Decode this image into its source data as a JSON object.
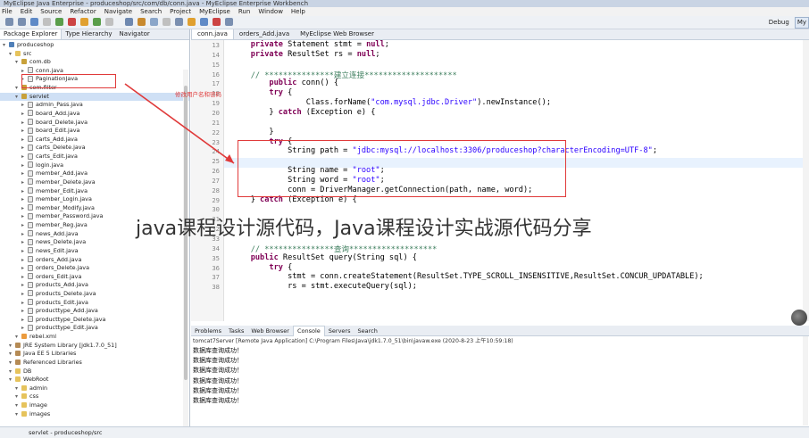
{
  "window_title": "MyEclipse Java Enterprise - produceshop/src/com/db/conn.java - MyEclipse Enterprise Workbench",
  "menu": [
    "File",
    "Edit",
    "Source",
    "Refactor",
    "Navigate",
    "Search",
    "Project",
    "MyEclipse",
    "Run",
    "Window",
    "Help"
  ],
  "perspectives": [
    "Debug",
    "My"
  ],
  "left_tabs": [
    "Package Explorer",
    "Type Hierarchy",
    "Navigator"
  ],
  "tree": [
    {
      "label": "produceshop",
      "indent": 0,
      "icon": "proj"
    },
    {
      "label": "src",
      "indent": 1,
      "icon": "fold"
    },
    {
      "label": "com.db",
      "indent": 2,
      "icon": "pkg"
    },
    {
      "label": "conn.java",
      "indent": 3,
      "icon": "jf"
    },
    {
      "label": "PaginationJava",
      "indent": 3,
      "icon": "jf"
    },
    {
      "label": "com.filter",
      "indent": 2,
      "icon": "pkg"
    },
    {
      "label": "servlet",
      "indent": 2,
      "icon": "pkg"
    },
    {
      "label": "admin_Pass.java",
      "indent": 3,
      "icon": "jf"
    },
    {
      "label": "board_Add.java",
      "indent": 3,
      "icon": "jf"
    },
    {
      "label": "board_Delete.java",
      "indent": 3,
      "icon": "jf"
    },
    {
      "label": "board_Edit.java",
      "indent": 3,
      "icon": "jf"
    },
    {
      "label": "carts_Add.java",
      "indent": 3,
      "icon": "jf"
    },
    {
      "label": "carts_Delete.java",
      "indent": 3,
      "icon": "jf"
    },
    {
      "label": "carts_Edit.java",
      "indent": 3,
      "icon": "jf"
    },
    {
      "label": "login.java",
      "indent": 3,
      "icon": "jf"
    },
    {
      "label": "member_Add.java",
      "indent": 3,
      "icon": "jf"
    },
    {
      "label": "member_Delete.java",
      "indent": 3,
      "icon": "jf"
    },
    {
      "label": "member_Edit.java",
      "indent": 3,
      "icon": "jf"
    },
    {
      "label": "member_Login.java",
      "indent": 3,
      "icon": "jf"
    },
    {
      "label": "member_Modify.java",
      "indent": 3,
      "icon": "jf"
    },
    {
      "label": "member_Password.java",
      "indent": 3,
      "icon": "jf"
    },
    {
      "label": "member_Reg.java",
      "indent": 3,
      "icon": "jf"
    },
    {
      "label": "news_Add.java",
      "indent": 3,
      "icon": "jf"
    },
    {
      "label": "news_Delete.java",
      "indent": 3,
      "icon": "jf"
    },
    {
      "label": "news_Edit.java",
      "indent": 3,
      "icon": "jf"
    },
    {
      "label": "orders_Add.java",
      "indent": 3,
      "icon": "jf"
    },
    {
      "label": "orders_Delete.java",
      "indent": 3,
      "icon": "jf"
    },
    {
      "label": "orders_Edit.java",
      "indent": 3,
      "icon": "jf"
    },
    {
      "label": "products_Add.java",
      "indent": 3,
      "icon": "jf"
    },
    {
      "label": "products_Delete.java",
      "indent": 3,
      "icon": "jf"
    },
    {
      "label": "products_Edit.java",
      "indent": 3,
      "icon": "jf"
    },
    {
      "label": "producttype_Add.java",
      "indent": 3,
      "icon": "jf"
    },
    {
      "label": "producttype_Delete.java",
      "indent": 3,
      "icon": "jf"
    },
    {
      "label": "producttype_Edit.java",
      "indent": 3,
      "icon": "jf"
    },
    {
      "label": "rebel.xml",
      "indent": 2,
      "icon": "xml"
    },
    {
      "label": "JRE System Library [jdk1.7.0_51]",
      "indent": 1,
      "icon": "lib"
    },
    {
      "label": "Java EE 5 Libraries",
      "indent": 1,
      "icon": "lib"
    },
    {
      "label": "Referenced Libraries",
      "indent": 1,
      "icon": "lib"
    },
    {
      "label": "DB",
      "indent": 1,
      "icon": "fold"
    },
    {
      "label": "WebRoot",
      "indent": 1,
      "icon": "fold"
    },
    {
      "label": "admin",
      "indent": 2,
      "icon": "fold"
    },
    {
      "label": "css",
      "indent": 2,
      "icon": "fold"
    },
    {
      "label": "image",
      "indent": 2,
      "icon": "fold"
    },
    {
      "label": "images",
      "indent": 2,
      "icon": "fold"
    }
  ],
  "editor_tabs": [
    "conn.java",
    "orders_Add.java",
    "MyEclipse Web Browser"
  ],
  "code_lines": [
    {
      "n": "13",
      "t": "    private Statement stmt = null;"
    },
    {
      "n": "14",
      "t": "    private ResultSet rs = null;"
    },
    {
      "n": "15",
      "t": ""
    },
    {
      "n": "16",
      "t": "    // ***************建立连接********************"
    },
    {
      "n": "17",
      "t": "        public conn() {"
    },
    {
      "n": "18",
      "t": "        try {"
    },
    {
      "n": "19",
      "t": "                Class.forName(\"com.mysql.jdbc.Driver\").newInstance();"
    },
    {
      "n": "20",
      "t": "        } catch (Exception e) {"
    },
    {
      "n": "21",
      "t": ""
    },
    {
      "n": "22",
      "t": "        }"
    },
    {
      "n": "23",
      "t": "        try {"
    },
    {
      "n": "24",
      "t": "            String path = \"jdbc:mysql://localhost:3306/produceshop?characterEncoding=UTF-8\";"
    },
    {
      "n": "25",
      "t": ""
    },
    {
      "n": "26",
      "t": "            String name = \"root\";"
    },
    {
      "n": "27",
      "t": "            String word = \"root\";"
    },
    {
      "n": "28",
      "t": "            conn = DriverManager.getConnection(path, name, word);"
    },
    {
      "n": "29",
      "t": "    } catch (Exception e) {"
    },
    {
      "n": "30",
      "t": ""
    },
    {
      "n": "31",
      "t": ""
    },
    {
      "n": "32",
      "t": ""
    },
    {
      "n": "33",
      "t": ""
    },
    {
      "n": "34",
      "t": "    // ***************查询*******************"
    },
    {
      "n": "35",
      "t": "    public ResultSet query(String sql) {"
    },
    {
      "n": "36",
      "t": "        try {"
    },
    {
      "n": "37",
      "t": "            stmt = conn.createStatement(ResultSet.TYPE_SCROLL_INSENSITIVE,ResultSet.CONCUR_UPDATABLE);"
    },
    {
      "n": "38",
      "t": "            rs = stmt.executeQuery(sql);"
    }
  ],
  "annotation_label": "修改用户名和密码",
  "overlay_title": "java课程设计源代码，Java课程设计实战源代码分享",
  "console_tabs": [
    "Problems",
    "Tasks",
    "Web Browser",
    "Console",
    "Servers",
    "Search"
  ],
  "console_header": "tomcat7Server [Remote Java Application] C:\\Program Files\\Java\\jdk1.7.0_51\\bin\\javaw.exe (2020-8-23 上午10:59:18)",
  "console_lines": [
    "数据库查询成功！",
    "数据库查询成功！",
    "数据库查询成功！",
    "数据库查询成功！",
    "数据库查询成功！",
    "数据库查询成功！"
  ],
  "status_text": "servlet - produceshop/src",
  "colors": {
    "highlight_box": "#e03a3a",
    "keyword": "#7f0055",
    "string": "#2a00ff",
    "comment": "#3f7f5f"
  }
}
